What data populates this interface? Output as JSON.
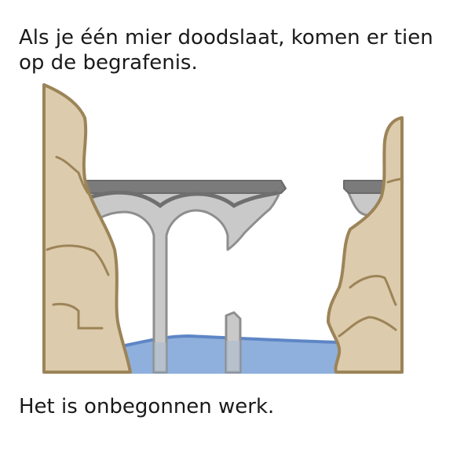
{
  "captions": {
    "top": "Als je één mier doodslaat, komen er tien op de begrafenis.",
    "bottom": "Het is onbegonnen werk."
  },
  "illustration": {
    "subject": "broken bridge over river between two cliffs",
    "colors": {
      "rock_fill": "#dccbac",
      "rock_stroke": "#9c8458",
      "bridge_deck": "#7b7b7b",
      "bridge_arch": "#c9c9c9",
      "bridge_stroke": "#8e8e8e",
      "water_fill": "#8fb0dc",
      "water_stroke": "#5e86c6"
    }
  }
}
